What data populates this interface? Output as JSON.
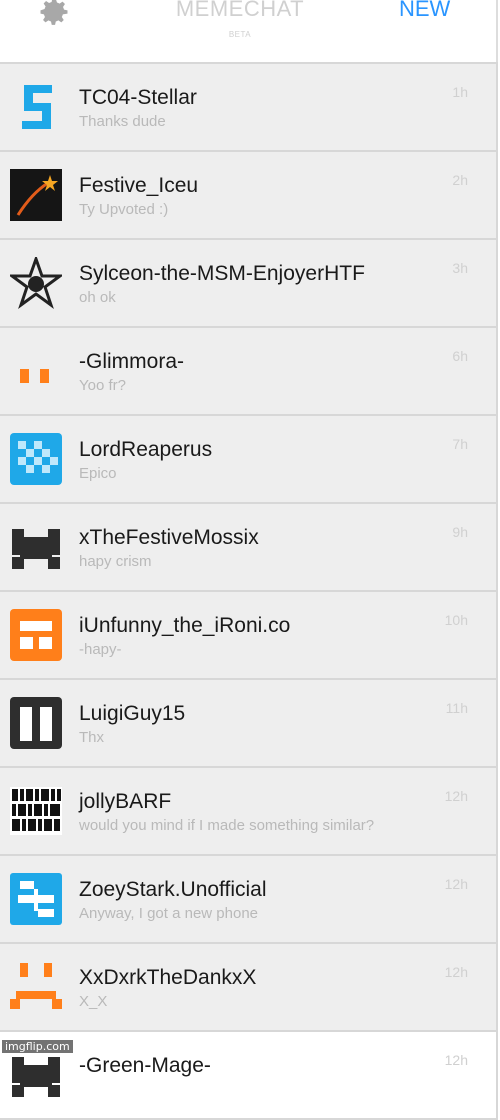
{
  "header": {
    "settings_icon": "gear-icon",
    "title": "MEMECHAT",
    "subtitle": "BETA",
    "new_label": "NEW"
  },
  "chats": [
    {
      "name": "TC04-Stellar",
      "preview": "Thanks dude",
      "time": "1h",
      "avatar": "blue-s-pixel-icon",
      "bg": "gray"
    },
    {
      "name": "Festive_Iceu",
      "preview": "Ty Upvoted :)",
      "time": "2h",
      "avatar": "shooting-star-icon",
      "bg": "gray"
    },
    {
      "name": "Sylceon-the-MSM-EnjoyerHTF",
      "preview": "oh ok",
      "time": "3h",
      "avatar": "star-emblem-icon",
      "bg": "gray"
    },
    {
      "name": "-Glimmora-",
      "preview": "Yoo fr?",
      "time": "6h",
      "avatar": "orange-bars-icon",
      "bg": "gray"
    },
    {
      "name": "LordReaperus",
      "preview": "Epico",
      "time": "7h",
      "avatar": "blue-checker-icon",
      "bg": "gray"
    },
    {
      "name": "xTheFestiveMossix",
      "preview": "hapy crism",
      "time": "9h",
      "avatar": "dark-pixel-icon",
      "bg": "gray"
    },
    {
      "name": "iUnfunny_the_iRoni.co",
      "preview": "-hapy-",
      "time": "10h",
      "avatar": "orange-block-icon",
      "bg": "gray"
    },
    {
      "name": "LuigiGuy15",
      "preview": "Thx",
      "time": "11h",
      "avatar": "dark-square-icon",
      "bg": "gray"
    },
    {
      "name": "jollyBARF",
      "preview": "would you mind if I made something similar?",
      "time": "12h",
      "avatar": "binary-code-icon",
      "bg": "gray"
    },
    {
      "name": "ZoeyStark.Unofficial",
      "preview": "Anyway, I got a new phone",
      "time": "12h",
      "avatar": "blue-swastika-pixel-icon",
      "bg": "gray"
    },
    {
      "name": "XxDxrkTheDankxX",
      "preview": "X_X",
      "time": "12h",
      "avatar": "orange-face-icon",
      "bg": "gray"
    },
    {
      "name": "-Green-Mage-",
      "preview": "",
      "time": "12h",
      "avatar": "dark-pixel-icon",
      "bg": "white"
    }
  ],
  "watermark": "imgflip.com"
}
